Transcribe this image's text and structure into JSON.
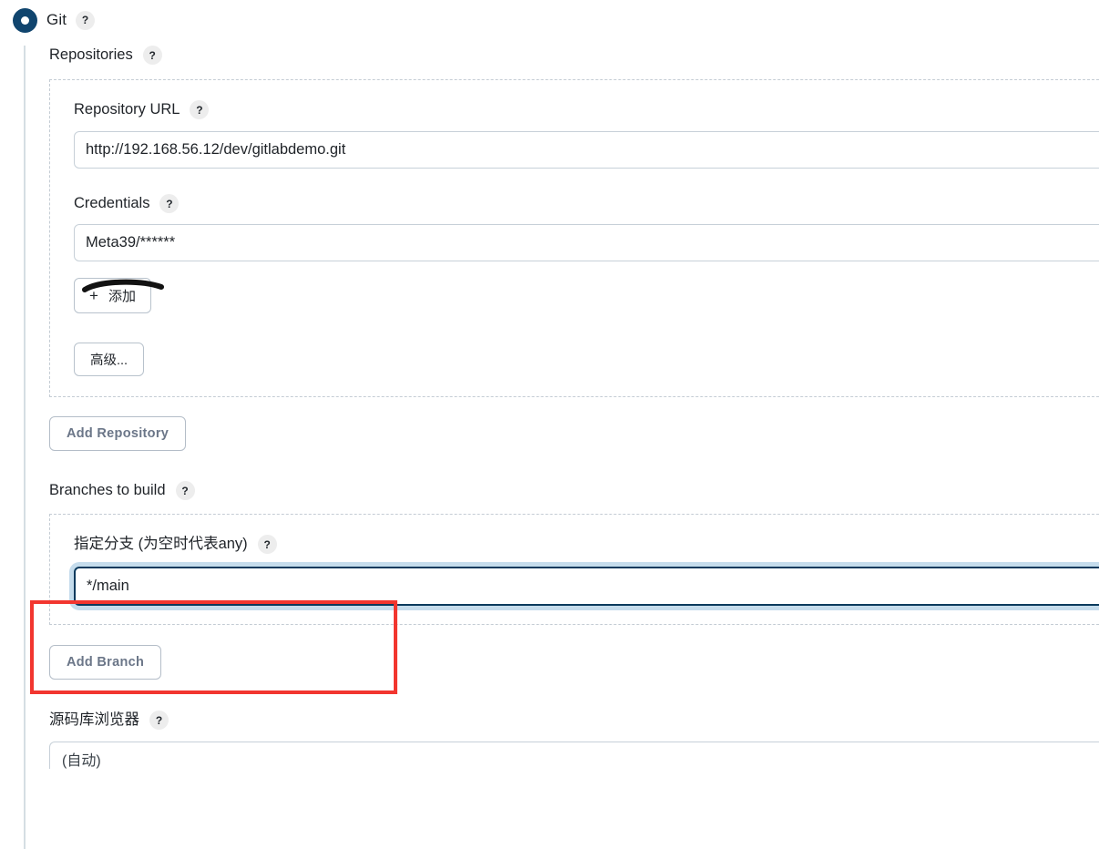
{
  "scm": {
    "option_label": "Git",
    "help_glyph": "?"
  },
  "repositories": {
    "section_label": "Repositories",
    "url": {
      "label": "Repository URL",
      "value": "http://192.168.56.12/dev/gitlabdemo.git"
    },
    "credentials": {
      "label": "Credentials",
      "value": "Meta39/******",
      "add_button": "添加",
      "add_button_icon": "+",
      "advanced_button": "高级..."
    },
    "add_repository_button": "Add Repository"
  },
  "branches": {
    "section_label": "Branches to build",
    "specifier": {
      "label": "指定分支 (为空时代表any)",
      "value": "*/main"
    },
    "add_branch_button": "Add Branch"
  },
  "browser": {
    "section_label": "源码库浏览器",
    "selected_value": "(自动)"
  },
  "annotations": {
    "highlight_color": "#f2362f",
    "stroke_color": "#1a1a1a"
  }
}
